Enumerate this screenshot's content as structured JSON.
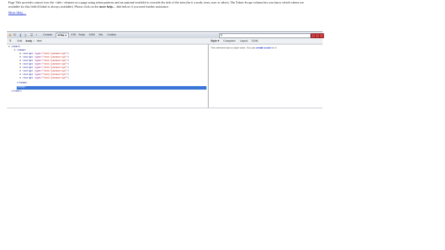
{
  "help": {
    "text_before": "Page Title provides control over the <title> element on a page using token patterns and an optional textfield to override the title of the item (be it a node, term, user or other). The Token Scope column lets you know which tokens are available for this field (Global is always available). Please click on the ",
    "emph": "more help…",
    "text_after": " link below if you need further assistance.",
    "more_link": "More Help…"
  },
  "firebug": {
    "panel_tabs": [
      "Console",
      "HTML",
      "CSS",
      "Script",
      "DOM",
      "Net",
      "Cookies"
    ],
    "active_tab": "HTML",
    "active_tab_arrow": "▾",
    "subbar": {
      "edit": "Edit",
      "crumb_body": "body",
      "crumb_sep": "<",
      "crumb_html": "html"
    },
    "tree": {
      "html_open": "<html>",
      "head_open": "<head>",
      "script_tag": "<script",
      "script_attr": " type=",
      "script_val": "\"text/javascript\"",
      "script_close": ">",
      "head_close": "</head>",
      "body": "<body>",
      "html_close": "</html>"
    },
    "side_tabs": [
      "Style ▾",
      "Computed",
      "Layout",
      "DOM"
    ],
    "side_message_before": "This element has no style rules. You can ",
    "side_message_link": "create a rule",
    "side_message_after": " for it."
  }
}
